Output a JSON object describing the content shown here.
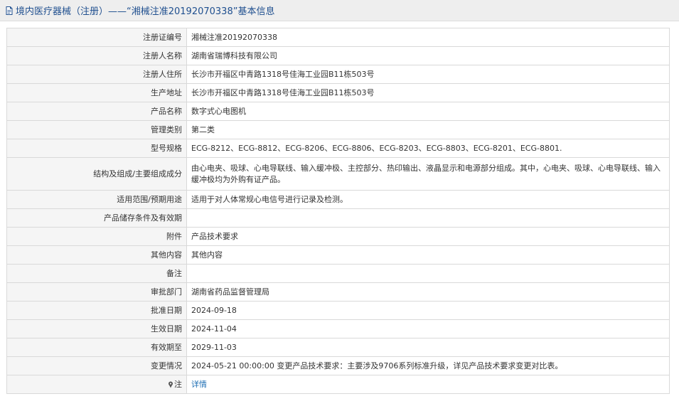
{
  "header": {
    "title": "境内医疗器械（注册）——“湘械注准20192070338”基本信息"
  },
  "fields": [
    {
      "label": "注册证编号",
      "value": "湘械注准20192070338"
    },
    {
      "label": "注册人名称",
      "value": "湖南省瑞博科技有限公司"
    },
    {
      "label": "注册人住所",
      "value": "长沙市开福区中青路1318号佳海工业园B11栋503号"
    },
    {
      "label": "生产地址",
      "value": "长沙市开福区中青路1318号佳海工业园B11栋503号"
    },
    {
      "label": "产品名称",
      "value": "数字式心电图机"
    },
    {
      "label": "管理类别",
      "value": "第二类"
    },
    {
      "label": "型号规格",
      "value": "ECG-8212、ECG-8812、ECG-8206、ECG-8806、ECG-8203、ECG-8803、ECG-8201、ECG-8801."
    },
    {
      "label": "结构及组成/主要组成成分",
      "value": "由心电夹、吸球、心电导联线、输入缓冲极、主控部分、热印输出、液晶显示和电源部分组成。其中，心电夹、吸球、心电导联线、输入缓冲极均为外购有证产品。"
    },
    {
      "label": "适用范围/预期用途",
      "value": "适用于对人体常规心电信号进行记录及检测。"
    },
    {
      "label": "产品储存条件及有效期",
      "value": ""
    },
    {
      "label": "附件",
      "value": "产品技术要求"
    },
    {
      "label": "其他内容",
      "value": "其他内容"
    },
    {
      "label": "备注",
      "value": ""
    },
    {
      "label": "审批部门",
      "value": "湖南省药品监督管理局"
    },
    {
      "label": "批准日期",
      "value": "2024-09-18"
    },
    {
      "label": "生效日期",
      "value": "2024-11-04"
    },
    {
      "label": "有效期至",
      "value": "2029-11-03"
    },
    {
      "label": "变更情况",
      "value": "2024-05-21 00:00:00 变更产品技术要求：主要涉及9706系列标准升级，详见产品技术要求变更对比表。"
    }
  ],
  "note": {
    "label": "注",
    "icon": "pin-icon",
    "link_text": "详情"
  },
  "colors": {
    "header_text": "#1f4f8f",
    "link": "#1f6fb4",
    "label_bg": "#f5f5f5",
    "border": "#d9d9d9"
  }
}
